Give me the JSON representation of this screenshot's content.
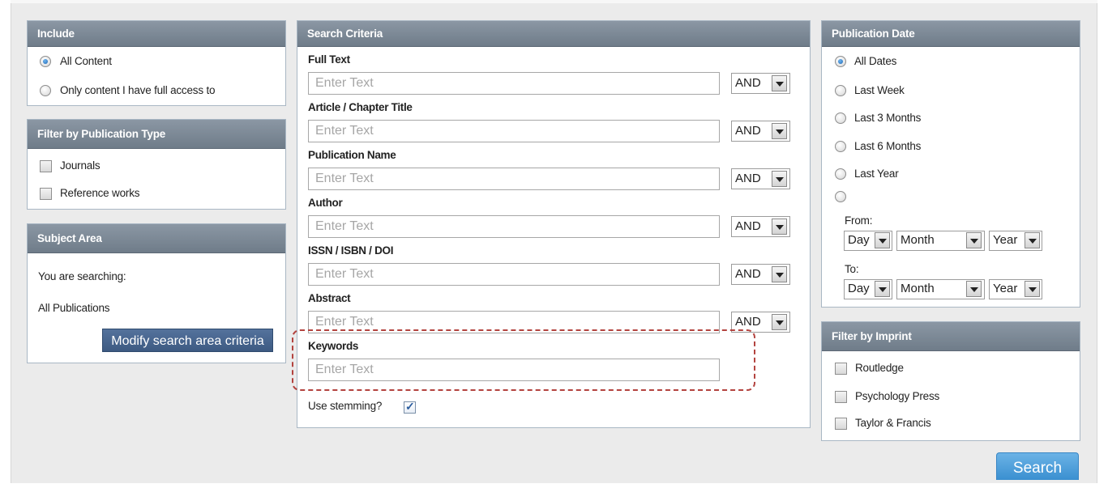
{
  "include": {
    "header": "Include",
    "options": [
      {
        "label": "All Content",
        "selected": true
      },
      {
        "label": "Only content I have full access to",
        "selected": false
      }
    ]
  },
  "pubtype": {
    "header": "Filter by Publication Type",
    "options": [
      {
        "label": "Journals",
        "checked": false
      },
      {
        "label": "Reference works",
        "checked": false
      }
    ]
  },
  "subject": {
    "header": "Subject Area",
    "searching_label": "You are searching:",
    "scope": "All Publications",
    "modify_button": "Modify search area criteria"
  },
  "criteria": {
    "header": "Search Criteria",
    "fields": [
      {
        "label": "Full Text",
        "placeholder": "Enter Text",
        "operator": "AND"
      },
      {
        "label": "Article / Chapter Title",
        "placeholder": "Enter Text",
        "operator": "AND"
      },
      {
        "label": "Publication Name",
        "placeholder": "Enter Text",
        "operator": "AND"
      },
      {
        "label": "Author",
        "placeholder": "Enter Text",
        "operator": "AND"
      },
      {
        "label": "ISSN / ISBN / DOI",
        "placeholder": "Enter Text",
        "operator": "AND"
      },
      {
        "label": "Abstract",
        "placeholder": "Enter Text",
        "operator": "AND"
      },
      {
        "label": "Keywords",
        "placeholder": "Enter Text"
      }
    ],
    "stemming_label": "Use stemming?",
    "stemming_checked": true
  },
  "pubdate": {
    "header": "Publication Date",
    "options": [
      {
        "label": "All Dates",
        "selected": true
      },
      {
        "label": "Last Week",
        "selected": false
      },
      {
        "label": "Last 3 Months",
        "selected": false
      },
      {
        "label": "Last 6 Months",
        "selected": false
      },
      {
        "label": "Last Year",
        "selected": false
      },
      {
        "label": "",
        "selected": false
      }
    ],
    "from_label": "From:",
    "to_label": "To:",
    "day": "Day",
    "month": "Month",
    "year": "Year"
  },
  "imprint": {
    "header": "Filter by Imprint",
    "options": [
      {
        "label": "Routledge",
        "checked": false
      },
      {
        "label": "Psychology Press",
        "checked": false
      },
      {
        "label": "Taylor & Francis",
        "checked": false
      }
    ]
  },
  "search_button": "Search",
  "colors": {
    "panel_header": "#7d8996",
    "button_blue": "#4a6890",
    "search_blue": "#4c9cd9",
    "highlight_dash": "#b3433f"
  }
}
